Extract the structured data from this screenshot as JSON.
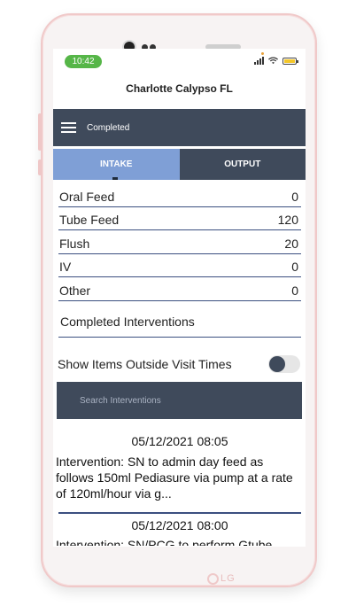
{
  "status_bar": {
    "time": "10:42"
  },
  "app": {
    "title": "Charlotte Calypso FL"
  },
  "topbar": {
    "title": "Completed"
  },
  "tabs": [
    {
      "label": "INTAKE",
      "active": true
    },
    {
      "label": "OUTPUT",
      "active": false
    }
  ],
  "intake_rows": [
    {
      "label": "Oral Feed",
      "value": "0"
    },
    {
      "label": "Tube Feed",
      "value": "120"
    },
    {
      "label": "Flush",
      "value": "20"
    },
    {
      "label": "IV",
      "value": "0"
    },
    {
      "label": "Other",
      "value": "0"
    }
  ],
  "completed_interventions": {
    "heading": "Completed Interventions"
  },
  "toggle": {
    "label": "Show Items Outside Visit Times",
    "on": false
  },
  "search": {
    "placeholder": "Search Interventions"
  },
  "entries": [
    {
      "datetime": "05/12/2021 08:05",
      "text": "Intervention: SN to admin day feed as follows 150ml Pediasure via pump at a rate of 120ml/hour via g..."
    },
    {
      "datetime": "05/12/2021 08:00",
      "text": "Intervention: SN/PCG to perform Gtube"
    }
  ],
  "device": {
    "brand": "LG"
  },
  "colors": {
    "navy": "#3f4a5b",
    "tab_active": "#7f9fd6",
    "time_pill": "#56b648",
    "divider": "#3b4f80",
    "phone_frame": "#f0c9c9"
  }
}
